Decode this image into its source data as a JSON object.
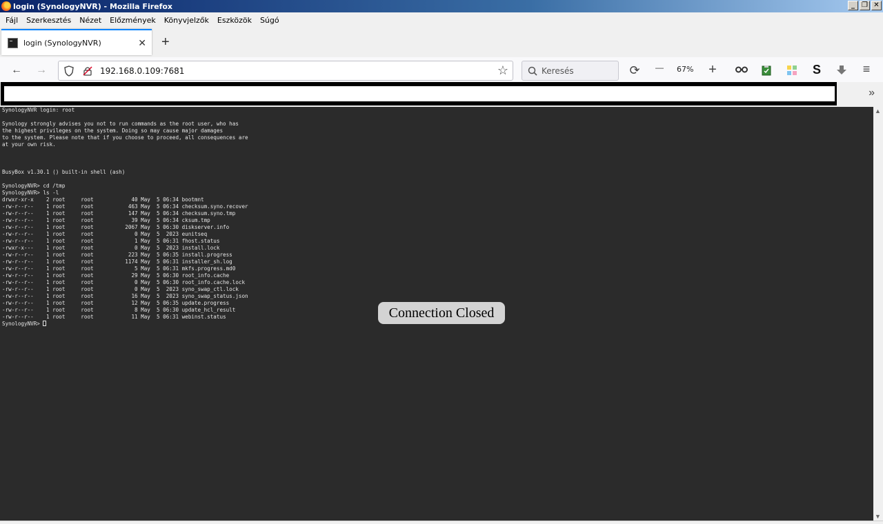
{
  "window": {
    "title": "login (SynologyNVR) - Mozilla Firefox",
    "controls": [
      "_",
      "❐",
      "✕"
    ]
  },
  "menu": [
    "Fájl",
    "Szerkesztés",
    "Nézet",
    "Előzmények",
    "Könyvjelzők",
    "Eszközök",
    "Súgó"
  ],
  "tab": {
    "title": "login (SynologyNVR)",
    "close": "✕",
    "new_tab": "+"
  },
  "nav": {
    "url": "192.168.0.109:7681",
    "search_placeholder": "Keresés",
    "zoom": "67%"
  },
  "terminal": {
    "lines": [
      "SynologyNVR login: root",
      "",
      "Synology strongly advises you not to run commands as the root user, who has",
      "the highest privileges on the system. Doing so may cause major damages",
      "to the system. Please note that if you choose to proceed, all consequences are",
      "at your own risk.",
      "",
      "",
      "",
      "BusyBox v1.30.1 () built-in shell (ash)",
      "",
      "SynologyNVR> cd /tmp",
      "SynologyNVR> ls -l",
      "drwxr-xr-x    2 root     root            40 May  5 06:34 bootmnt",
      "-rw-r--r--    1 root     root           463 May  5 06:34 checksum.syno.recover",
      "-rw-r--r--    1 root     root           147 May  5 06:34 checksum.syno.tmp",
      "-rw-r--r--    1 root     root            39 May  5 06:34 cksum.tmp",
      "-rw-r--r--    1 root     root          2067 May  5 06:30 diskserver.info",
      "-rw-r--r--    1 root     root             0 May  5  2023 eunitseq",
      "-rw-r--r--    1 root     root             1 May  5 06:31 fhost.status",
      "-rwxr-x---    1 root     root             0 May  5  2023 install.lock",
      "-rw-r--r--    1 root     root           223 May  5 06:35 install.progress",
      "-rw-r--r--    1 root     root          1174 May  5 06:31 installer_sh.log",
      "-rw-r--r--    1 root     root             5 May  5 06:31 mkfs.progress.md0",
      "-rw-r--r--    1 root     root            29 May  5 06:30 root_info.cache",
      "-rw-r--r--    1 root     root             0 May  5 06:30 root_info.cache.lock",
      "-rw-r--r--    1 root     root             0 May  5  2023 syno_swap_ctl.lock",
      "-rw-r--r--    1 root     root            16 May  5  2023 syno_swap_status.json",
      "-rw-r--r--    1 root     root            12 May  5 06:35 update.progress",
      "-rw-r--r--    1 root     root             8 May  5 06:30 update_hcl_result",
      "-rw-r--r--    1 root     root            11 May  5 06:31 webinst.status"
    ],
    "prompt": "SynologyNVR> "
  },
  "overlay": {
    "message": "Connection Closed"
  },
  "icons": {
    "back": "←",
    "forward": "→",
    "reload": "⟳",
    "zoom_out": "—",
    "zoom_in": "+",
    "menu": "≡",
    "overflow": "»",
    "star": "☆",
    "search": "⌕"
  }
}
